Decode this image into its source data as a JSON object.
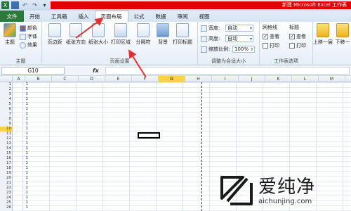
{
  "window": {
    "title": "新建 Microsoft Excel 工作表"
  },
  "quick_access": {
    "icons": [
      "excel-logo-icon",
      "save-icon",
      "undo-icon",
      "redo-icon",
      "customize-icon"
    ]
  },
  "tabs": [
    {
      "label": "文件",
      "kind": "file"
    },
    {
      "label": "开始"
    },
    {
      "label": "工具箱"
    },
    {
      "label": "插入"
    },
    {
      "label": "页面布局",
      "active": true
    },
    {
      "label": "公式"
    },
    {
      "label": "数据"
    },
    {
      "label": "审阅"
    },
    {
      "label": "视图"
    }
  ],
  "ribbon": {
    "theme_group": {
      "label": "主题",
      "theme_btn": "主题",
      "colors": "颜色",
      "fonts": "字体",
      "effects": "效果"
    },
    "page_setup_group": {
      "label": "页面设置",
      "margins": "页边距",
      "orientation": "纸张方向",
      "size": "纸张大小",
      "print_area": "打印区域",
      "breaks": "分隔符",
      "background": "背景",
      "print_titles": "打印标题"
    },
    "scale_group": {
      "label": "调整为合适大小",
      "width_label": "宽度:",
      "width_value": "自动",
      "height_label": "高度:",
      "height_value": "自动",
      "scale_label": "缩放比例:",
      "scale_value": "100%"
    },
    "sheet_options_group": {
      "label": "工作表选项",
      "gridlines": "网格线",
      "headings": "标题",
      "view_label": "查看",
      "print_label": "打印",
      "gridlines_view": true,
      "gridlines_print": false,
      "headings_view": true,
      "headings_print": false
    },
    "arrange_group": {
      "bring_forward": "上移一层",
      "send_backward": "下移一"
    }
  },
  "formula_bar": {
    "name_box": "G10",
    "fx": "fx",
    "value": ""
  },
  "grid": {
    "columns": [
      "A",
      "B",
      "C",
      "D",
      "E",
      "F",
      "G",
      "H",
      "I",
      "J",
      "K",
      "L",
      "M"
    ],
    "selected_column": "G",
    "rows": [
      "1",
      "2",
      "3",
      "4",
      "5",
      "6",
      "7",
      "8",
      "9",
      "10",
      "11",
      "12",
      "13",
      "14",
      "15",
      "16",
      "17",
      "18",
      "19",
      "20",
      "21",
      "22",
      "23",
      "24",
      "25",
      "26"
    ],
    "selected_row": "10",
    "column_a_values": [
      "1",
      "1",
      "1",
      "1",
      "1",
      "1",
      "1",
      "1",
      "1",
      "1",
      "1",
      "1",
      "1",
      "1",
      "1",
      "1",
      "1",
      "1",
      "1",
      "1",
      "1",
      "1",
      "1",
      "1",
      "1",
      "1"
    ]
  },
  "watermark": {
    "brand": "爱纯净",
    "url": "aichunjing.com"
  },
  "colors": {
    "file_tab": "#2a7a3b",
    "title_red": "#e00000",
    "selected_header": "#f7d24a",
    "arrow": "#e03030"
  }
}
